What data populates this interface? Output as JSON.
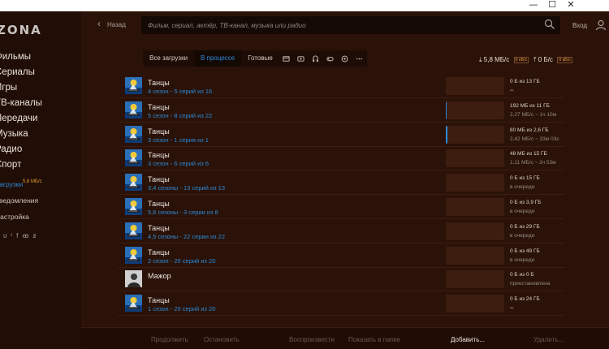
{
  "window": {
    "minimize": "—",
    "maximize": "☐",
    "close": "✕"
  },
  "app": {
    "logo": "ZONA"
  },
  "sidebar": {
    "items": [
      {
        "label": "Фильмы"
      },
      {
        "label": "Сериалы"
      },
      {
        "label": "Игры"
      },
      {
        "label": "ТВ-каналы"
      },
      {
        "label": "Передачи"
      },
      {
        "label": "Музыка"
      },
      {
        "label": "Радио"
      },
      {
        "label": "Спорт"
      },
      {
        "label": "Загрузки",
        "badge": "5,8 МБ/с"
      },
      {
        "label": "Уведомления"
      },
      {
        "label": "Настройка"
      }
    ],
    "social": [
      "vk-icon",
      "twitter-icon",
      "facebook-icon",
      "odnoklassniki-icon",
      "zona-icon"
    ]
  },
  "topbar": {
    "back_label": "Назад",
    "search_placeholder": "Фильм, сериал, актёр, ТВ-канал, музыка или радио",
    "login_label": "Вход"
  },
  "tabs": {
    "all": "Все загрузки",
    "in_progress": "В процессе",
    "ready": "Готовые",
    "icons": [
      "film-icon",
      "series-icon",
      "music-icon",
      "games-icon",
      "sport-icon",
      "more-icon"
    ]
  },
  "speed": {
    "down": "5,8 МБ/с",
    "down_limit": "0 кБ/с",
    "up": "0 Б/с",
    "up_limit": "0 кБ/с"
  },
  "downloads": [
    {
      "title": "Танцы",
      "subtitle": "4 сезон - 5 серий из 16",
      "size": "0 Б из 13 ГБ",
      "status": "∞",
      "progress": 0
    },
    {
      "title": "Танцы",
      "subtitle": "5 сезон - 8 серий из 22",
      "size": "192 МБ из 11 ГБ",
      "status": "2,27 МБ/с ~ 1ч 10м",
      "progress": 0.02
    },
    {
      "title": "Танцы",
      "subtitle": "3 сезон - 1 серия из 1",
      "size": "80 МБ из 2,6 ГБ",
      "status": "2,42 МБ/с ~ 33м 03с",
      "progress": 0.03
    },
    {
      "title": "Танцы",
      "subtitle": "3 сезон - 6 серий из 6",
      "size": "48 МБ из 15 ГБ",
      "status": "1,11 МБ/с ~ 2ч 53м",
      "progress": 0
    },
    {
      "title": "Танцы",
      "subtitle": "3,4 сезоны - 13 серий из 13",
      "size": "0 Б из 15 ГБ",
      "status": "в очереди",
      "progress": 0
    },
    {
      "title": "Танцы",
      "subtitle": "5,6 сезоны - 3 серии из 8",
      "size": "0 Б из 3,9 ГБ",
      "status": "в очереди",
      "progress": 0
    },
    {
      "title": "Танцы",
      "subtitle": "4,5 сезоны - 22 серии из 22",
      "size": "0 Б из 29 ГБ",
      "status": "в очереди",
      "progress": 0
    },
    {
      "title": "Танцы",
      "subtitle": "2 сезон - 20 серий из 20",
      "size": "0 Б из 49 ГБ",
      "status": "в очереди",
      "progress": 0
    },
    {
      "title": "Мажор",
      "subtitle": "",
      "size": "0 Б из 0 Б",
      "status": "приостановлена",
      "progress": 0
    },
    {
      "title": "Танцы",
      "subtitle": "1 сезон - 20 серий из 20",
      "size": "0 Б из 24 ГБ",
      "status": "∞",
      "progress": 0
    }
  ],
  "bottombar": {
    "resume": "Продолжить",
    "stop": "Остановить",
    "play": "Воспроизвести",
    "show_in_folder": "Показать в папке",
    "add": "Добавить...",
    "delete": "Удалить..."
  },
  "colors": {
    "accent": "#2d8ad8",
    "background": "#2a1208",
    "limit": "#e8a23c"
  }
}
